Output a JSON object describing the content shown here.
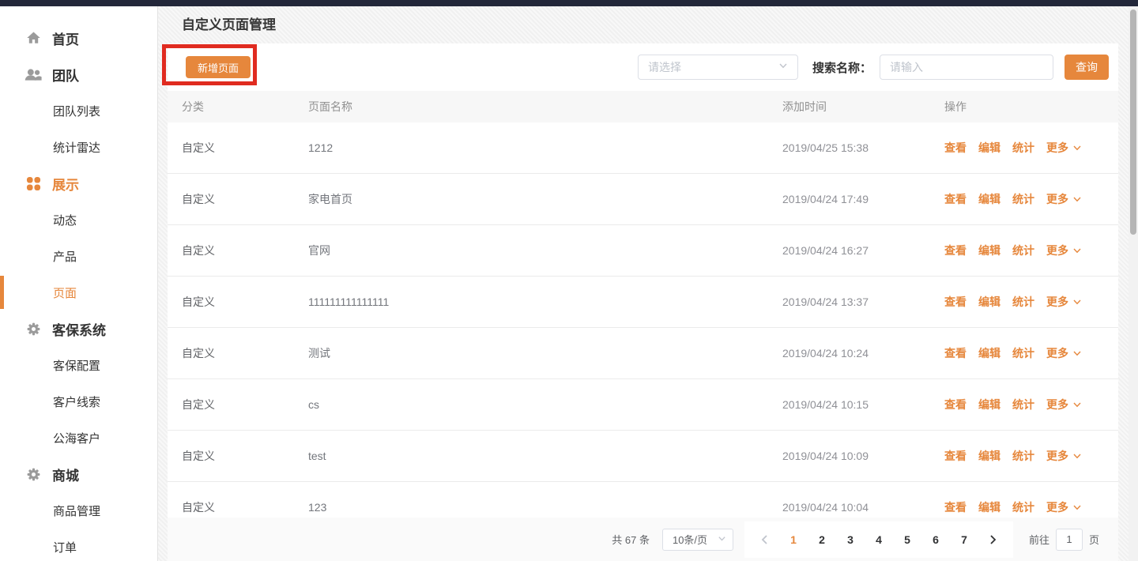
{
  "colors": {
    "accent": "#e6873c",
    "annotation_red": "#e02b20",
    "topbar": "#23273a"
  },
  "sidebar": {
    "items": [
      {
        "label": "首页",
        "icon": "home-icon",
        "level": 1
      },
      {
        "label": "团队",
        "icon": "team-icon",
        "level": 1
      },
      {
        "label": "团队列表",
        "level": 2
      },
      {
        "label": "统计雷达",
        "level": 2
      },
      {
        "label": "展示",
        "icon": "grid-icon",
        "level": 1,
        "highlighted": true
      },
      {
        "label": "动态",
        "level": 2
      },
      {
        "label": "产品",
        "level": 2
      },
      {
        "label": "页面",
        "level": 2,
        "active": true
      },
      {
        "label": "客保系统",
        "icon": "gear-icon",
        "level": 1
      },
      {
        "label": "客保配置",
        "level": 2
      },
      {
        "label": "客户线索",
        "level": 2
      },
      {
        "label": "公海客户",
        "level": 2
      },
      {
        "label": "商城",
        "icon": "gear-icon",
        "level": 1
      },
      {
        "label": "商品管理",
        "level": 2
      },
      {
        "label": "订单",
        "level": 2
      }
    ]
  },
  "header": {
    "title": "自定义页面管理"
  },
  "toolbar": {
    "add_button": "新增页面",
    "select_placeholder": "请选择",
    "search_label": "搜索名称：",
    "search_placeholder": "请输入",
    "query_button": "查询"
  },
  "table": {
    "columns": [
      "分类",
      "页面名称",
      "添加时间",
      "操作"
    ],
    "actions": [
      "查看",
      "编辑",
      "统计",
      "更多"
    ],
    "rows": [
      {
        "category": "自定义",
        "name": "1212",
        "time": "2019/04/25 15:38"
      },
      {
        "category": "自定义",
        "name": "家电首页",
        "time": "2019/04/24 17:49"
      },
      {
        "category": "自定义",
        "name": "官网",
        "time": "2019/04/24 16:27"
      },
      {
        "category": "自定义",
        "name": "111111111111111",
        "time": "2019/04/24 13:37"
      },
      {
        "category": "自定义",
        "name": "测试",
        "time": "2019/04/24 10:24"
      },
      {
        "category": "自定义",
        "name": "cs",
        "time": "2019/04/24 10:15"
      },
      {
        "category": "自定义",
        "name": "test",
        "time": "2019/04/24 10:09"
      },
      {
        "category": "自定义",
        "name": "123",
        "time": "2019/04/24 10:04"
      }
    ]
  },
  "pagination": {
    "total_label": "共 67 条",
    "page_size": "10条/页",
    "pages": [
      "1",
      "2",
      "3",
      "4",
      "5",
      "6",
      "7"
    ],
    "current_page": "1",
    "goto_label": "前往",
    "goto_value": "1",
    "goto_suffix": "页"
  }
}
